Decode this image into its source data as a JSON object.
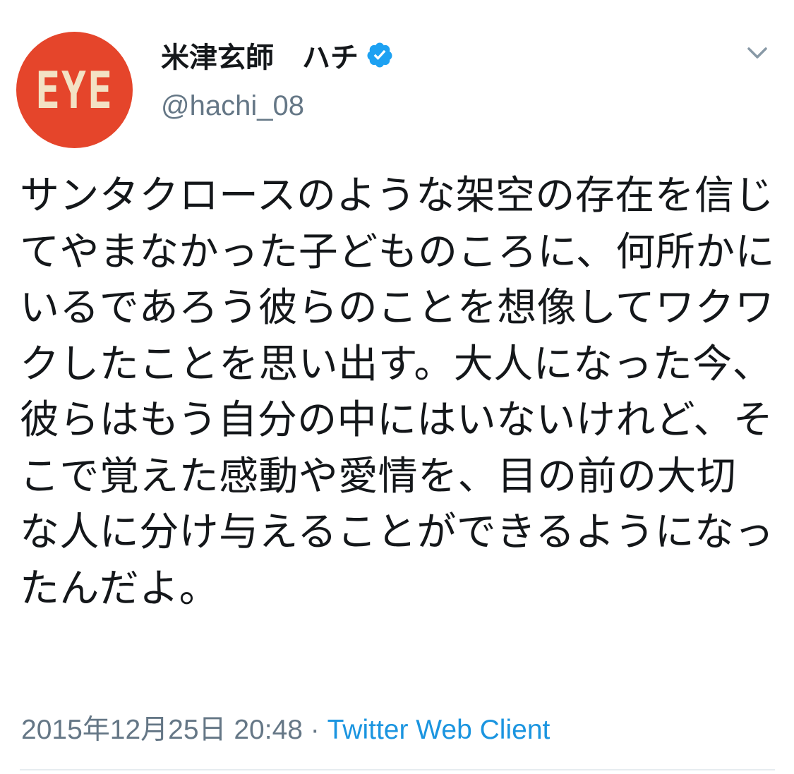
{
  "tweet": {
    "avatar": {
      "text": "EYE",
      "background_color": "#e5452b",
      "text_color": "#f3e2c4"
    },
    "display_name": "米津玄師　ハチ",
    "verified_icon": "verified-badge-icon",
    "handle": "@hachi_08",
    "menu_icon": "chevron-down-icon",
    "text": "サンタクロースのような架空の存在を信じてやまなかった子どものころに、何所かにいるであろう彼らのことを想像してワクワクしたことを思い出す。大人になった今、彼らはもう自分の中にはいないけれど、そこで覚えた感動や愛情を、目の前の大切な人に分け与えることができるようになったんだよ。",
    "timestamp": "2015年12月25日 20:48",
    "separator": " · ",
    "client": "Twitter Web Client",
    "colors": {
      "text": "#14171a",
      "secondary": "#657786",
      "link": "#1b95e0",
      "verified": "#1da1f2"
    }
  }
}
